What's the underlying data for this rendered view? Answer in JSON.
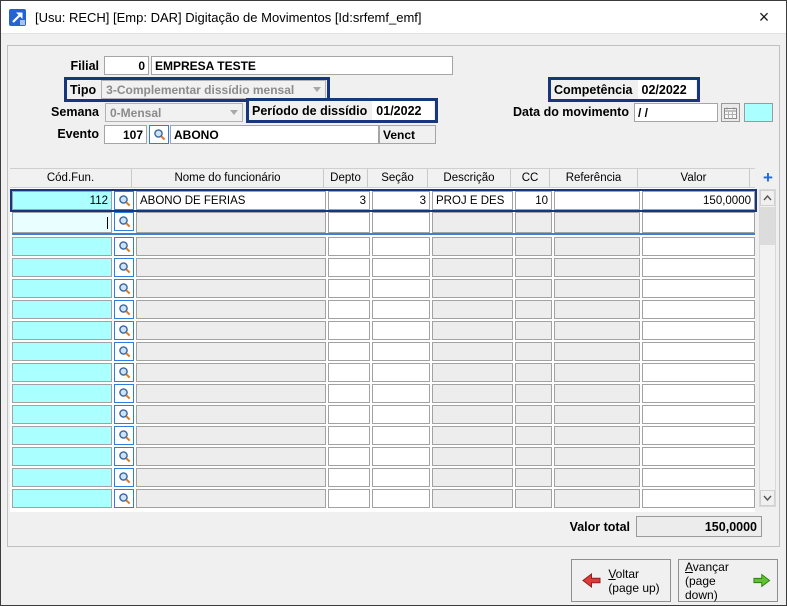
{
  "window": {
    "title": "[Usu: RECH] [Emp: DAR] Digitação de Movimentos [Id:srfemf_emf]"
  },
  "icons": {
    "close": "×",
    "add_row": "+"
  },
  "form": {
    "filial": {
      "label": "Filial",
      "code": "0",
      "name": "EMPRESA TESTE"
    },
    "tipo": {
      "label": "Tipo",
      "value": "3-Complementar dissídio mensal"
    },
    "competencia": {
      "label": "Competência",
      "value": "02/2022"
    },
    "semana": {
      "label": "Semana",
      "value": "0-Mensal"
    },
    "periodo_dissidio": {
      "label": "Período de dissídio",
      "value": "01/2022"
    },
    "data_movimento": {
      "label": "Data do movimento",
      "value": "/  /"
    },
    "evento": {
      "label": "Evento",
      "code": "107",
      "name": "ABONO",
      "venct": "Venct"
    }
  },
  "table": {
    "columns": [
      "Cód.Fun.",
      "Nome do funcionário",
      "Depto",
      "Seção",
      "Descrição",
      "CC",
      "Referência",
      "Valor"
    ],
    "rows": [
      {
        "cod": "112",
        "nome": "ABONO DE FERIAS",
        "depto": "3",
        "secao": "3",
        "descricao": "PROJ E DES",
        "cc": "10",
        "referencia": "",
        "valor": "150,0000"
      }
    ],
    "empty_row_count": 14,
    "active_row_index": 1
  },
  "footer": {
    "valor_total_label": "Valor total",
    "valor_total_value": "150,0000"
  },
  "buttons": {
    "voltar": {
      "line1": "Voltar",
      "line2": "(page up)"
    },
    "avancar": {
      "line1": "Avançar",
      "line2": "(page down)"
    }
  },
  "colors": {
    "accent_navy": "#17377d",
    "grid_cyan": "#aaffff",
    "active_cyan": "#e9ffff",
    "active_row_blue": "#3f7fd4",
    "plus_blue": "#2268d8",
    "lookup_border_blue": "#2f7de1",
    "arrow_red": "#de3a3a",
    "arrow_green": "#5fc232"
  }
}
